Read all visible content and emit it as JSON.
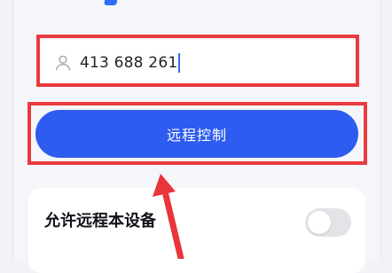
{
  "search": {
    "value": "413 688 261",
    "icon": "user-icon"
  },
  "primary_button": {
    "label": "远程控制"
  },
  "settings": {
    "allow_remote_label": "允许远程本设备",
    "toggle_on": false
  },
  "annotations": {
    "highlight_color": "#ea3a3f",
    "arrow_color": "#e8343a"
  },
  "colors": {
    "accent": "#2e5bf0",
    "page_background": "#f5f6fa",
    "card": "#ffffff"
  }
}
